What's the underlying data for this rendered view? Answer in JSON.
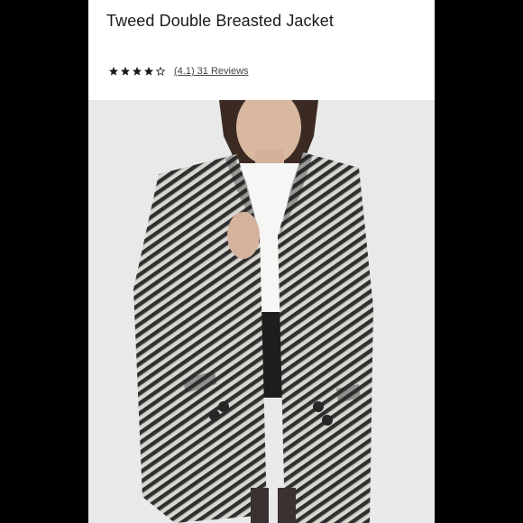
{
  "product": {
    "title": "Tweed Double Breasted Jacket",
    "rating_value": 4.1,
    "rating_max": 5,
    "stars_filled": 4,
    "rating_text": "(4.1) 31 Reviews"
  },
  "image": {
    "alt": "Model wearing a black and white tweed double breasted jacket over a white top"
  },
  "colors": {
    "frame": "#000000",
    "star": "#1a1a1a",
    "photo_bg": "#e9e9ea"
  }
}
